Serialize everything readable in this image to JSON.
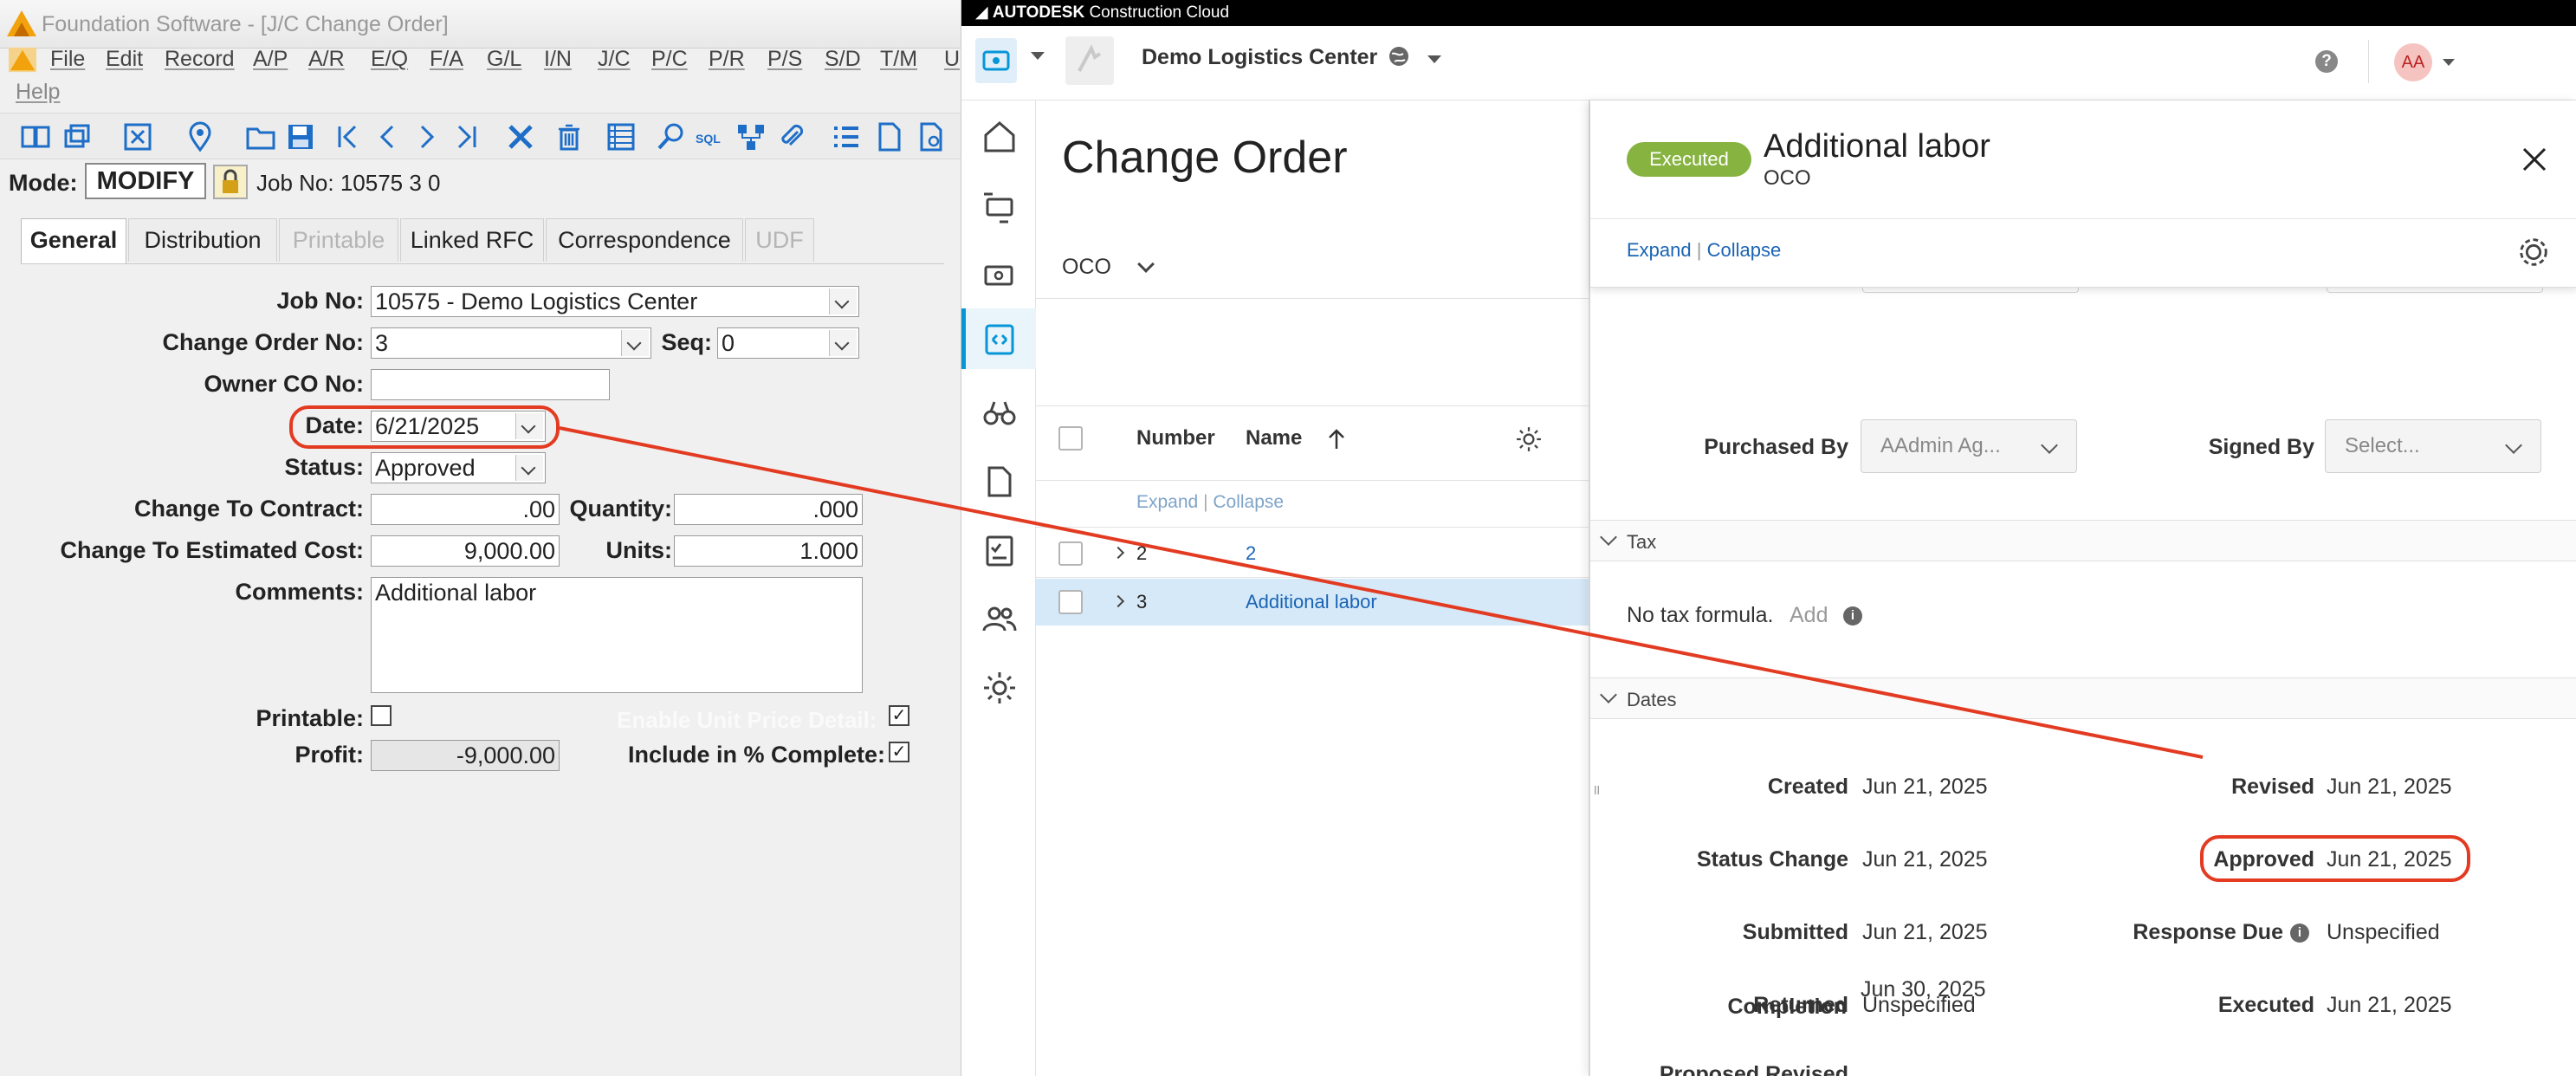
{
  "foundation": {
    "window_title": "Foundation Software - [J/C Change Order]",
    "menu": [
      "File",
      "Edit",
      "Record",
      "A/P",
      "A/R",
      "E/Q",
      "F/A",
      "G/L",
      "I/N",
      "J/C",
      "P/C",
      "P/R",
      "P/S",
      "S/D",
      "T/M",
      "U",
      "Help"
    ],
    "mode_label": "Mode:",
    "mode_value": "MODIFY",
    "job_info": "Job No: 10575  3  0",
    "tabs": [
      "General",
      "Distribution",
      "Printable",
      "Linked RFC",
      "Correspondence",
      "UDF"
    ],
    "form": {
      "job_no_label": "Job No:",
      "job_no_value": "10575 - Demo Logistics Center",
      "change_order_no_label": "Change Order No:",
      "change_order_no_value": "3",
      "seq_label": "Seq:",
      "seq_value": "0",
      "owner_co_label": "Owner CO No:",
      "owner_co_value": "",
      "date_label": "Date:",
      "date_value": "6/21/2025",
      "status_label": "Status:",
      "status_value": "Approved",
      "change_to_contract_label": "Change To Contract:",
      "change_to_contract_value": ".00",
      "quantity_label": "Quantity:",
      "quantity_value": ".000",
      "change_to_est_cost_label": "Change To Estimated Cost:",
      "change_to_est_cost_value": "9,000.00",
      "units_label": "Units:",
      "units_value": "1.000",
      "comments_label": "Comments:",
      "comments_value": "Additional labor",
      "printable_label": "Printable:",
      "printable_checked": false,
      "enable_unit_price_label": "Enable Unit Price Detail:",
      "enable_unit_price_checked": true,
      "profit_label": "Profit:",
      "profit_value": "-9,000.00",
      "include_pct_label": "Include in % Complete:",
      "include_pct_checked": true
    }
  },
  "acc": {
    "brand": "AUTODESK",
    "brand_suffix": "Construction Cloud",
    "project_name": "Demo Logistics Center",
    "avatar_initials": "AA",
    "help_glyph": "?",
    "page_title": "Change Order",
    "type_selector": "OCO",
    "list": {
      "col_number": "Number",
      "col_name": "Name",
      "expand": "Expand",
      "collapse": "Collapse",
      "rows": [
        {
          "number": "2",
          "name": "2"
        },
        {
          "number": "3",
          "name": "Additional labor"
        }
      ]
    },
    "detail": {
      "status_badge": "Executed",
      "title": "Additional labor",
      "subtitle": "OCO",
      "expand": "Expand",
      "collapse": "Collapse",
      "purchased_by_label": "Purchased By",
      "purchased_by_value": "AAdmin Ag...",
      "signed_by_label": "Signed By",
      "signed_by_value": "Select...",
      "tax_section": "Tax",
      "no_tax_text": "No tax formula.",
      "add_link": "Add",
      "dates_section": "Dates",
      "created_label": "Created",
      "created_value": "Jun 21, 2025",
      "revised_label": "Revised",
      "revised_value": "Jun 21, 2025",
      "status_change_label": "Status Change",
      "status_change_value": "Jun 21, 2025",
      "approved_label": "Approved",
      "approved_value": "Jun 21, 2025",
      "submitted_label": "Submitted",
      "submitted_value": "Jun 21, 2025",
      "response_due_label": "Response Due",
      "response_due_value": "Unspecified",
      "returned_label": "Returned",
      "returned_value": "Unspecified",
      "executed_label": "Executed",
      "executed_value": "Jun 21, 2025",
      "proposed_label_1": "Proposed Revised",
      "proposed_label_2": "Completion",
      "proposed_value": "Jun 30, 2025"
    }
  },
  "colors": {
    "annotation_red": "#e23b22",
    "executed_green": "#87b340",
    "link_blue": "#1a64b4",
    "selected_row": "#d6e9f8"
  }
}
